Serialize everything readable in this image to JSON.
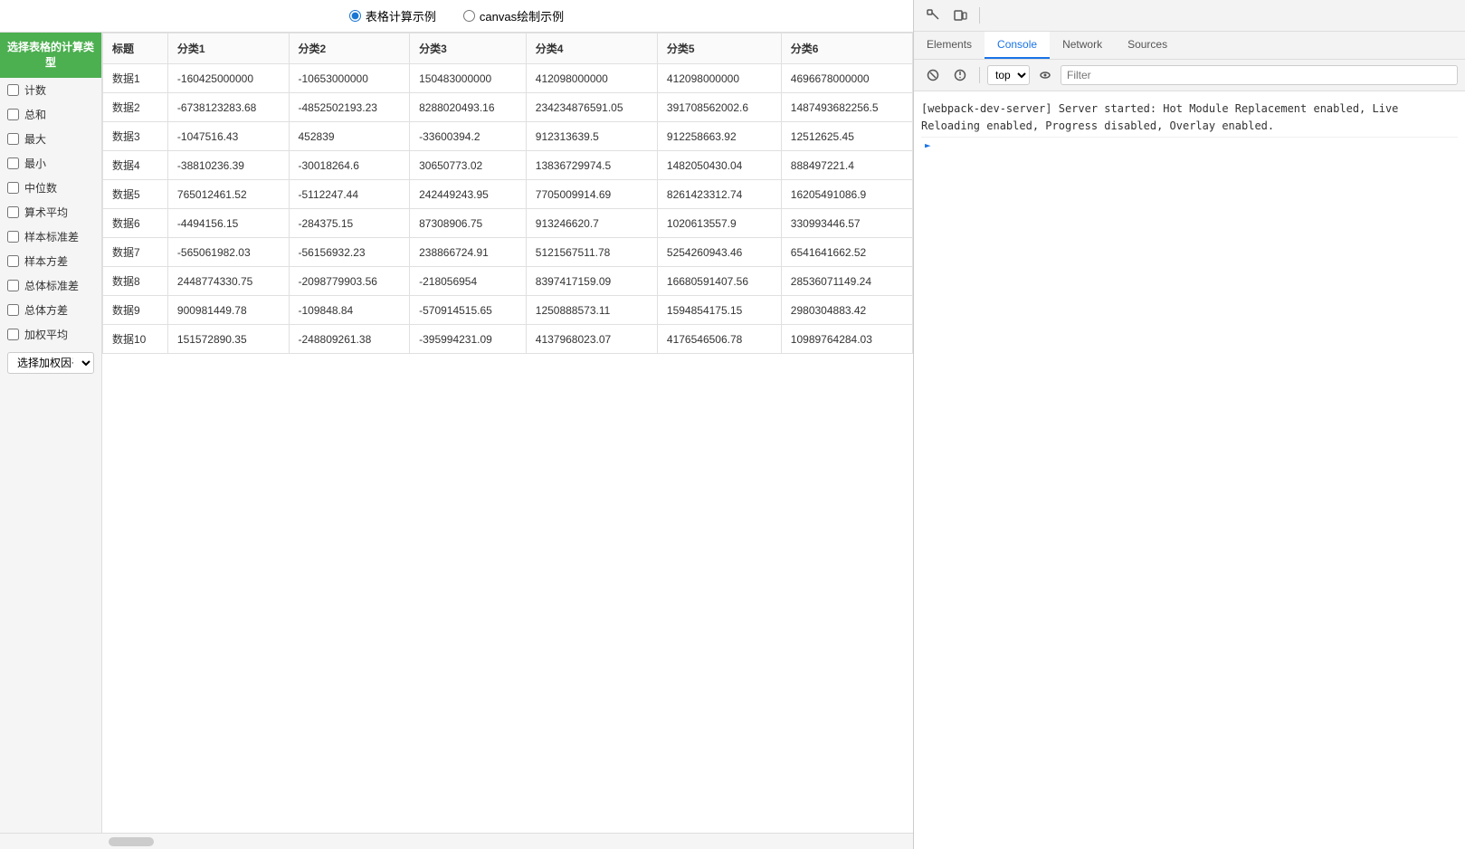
{
  "topbar": {
    "radio1_label": "表格计算示例",
    "radio2_label": "canvas绘制示例",
    "radio1_selected": true
  },
  "sidebar": {
    "title": "选择表格的计算类型",
    "items": [
      {
        "label": "计数",
        "checked": false
      },
      {
        "label": "总和",
        "checked": false
      },
      {
        "label": "最大",
        "checked": false
      },
      {
        "label": "最小",
        "checked": false
      },
      {
        "label": "中位数",
        "checked": false
      },
      {
        "label": "算术平均",
        "checked": false
      },
      {
        "label": "样本标准差",
        "checked": false
      },
      {
        "label": "样本方差",
        "checked": false
      },
      {
        "label": "总体标准差",
        "checked": false
      },
      {
        "label": "总体方差",
        "checked": false
      },
      {
        "label": "加权平均",
        "checked": false
      }
    ],
    "dropdown_placeholder": "选择加权因子",
    "dropdown_options": [
      "选择加权因子"
    ]
  },
  "table": {
    "headers": [
      "标题",
      "分类1",
      "分类2",
      "分类3",
      "分类4",
      "分类5",
      "分类6"
    ],
    "rows": [
      {
        "label": "数据1",
        "c1": "-160425000000",
        "c2": "-10653000000",
        "c3": "150483000000",
        "c4": "412098000000",
        "c5": "412098000000",
        "c6": "4696678000000"
      },
      {
        "label": "数据2",
        "c1": "-6738123283.68",
        "c2": "-4852502193.23",
        "c3": "8288020493.16",
        "c4": "234234876591.05",
        "c5": "391708562002.6",
        "c6": "1487493682256.5"
      },
      {
        "label": "数据3",
        "c1": "-1047516.43",
        "c2": "452839",
        "c3": "-33600394.2",
        "c4": "912313639.5",
        "c5": "912258663.92",
        "c6": "12512625.45"
      },
      {
        "label": "数据4",
        "c1": "-38810236.39",
        "c2": "-30018264.6",
        "c3": "30650773.02",
        "c4": "13836729974.5",
        "c5": "1482050430.04",
        "c6": "888497221.4"
      },
      {
        "label": "数据5",
        "c1": "765012461.52",
        "c2": "-5112247.44",
        "c3": "242449243.95",
        "c4": "7705009914.69",
        "c5": "8261423312.74",
        "c6": "16205491086.9"
      },
      {
        "label": "数据6",
        "c1": "-4494156.15",
        "c2": "-284375.15",
        "c3": "87308906.75",
        "c4": "913246620.7",
        "c5": "1020613557.9",
        "c6": "330993446.57"
      },
      {
        "label": "数据7",
        "c1": "-565061982.03",
        "c2": "-56156932.23",
        "c3": "238866724.91",
        "c4": "5121567511.78",
        "c5": "5254260943.46",
        "c6": "6541641662.52"
      },
      {
        "label": "数据8",
        "c1": "2448774330.75",
        "c2": "-2098779903.56",
        "c3": "-218056954",
        "c4": "8397417159.09",
        "c5": "16680591407.56",
        "c6": "28536071149.24"
      },
      {
        "label": "数据9",
        "c1": "900981449.78",
        "c2": "-109848.84",
        "c3": "-570914515.65",
        "c4": "1250888573.11",
        "c5": "1594854175.15",
        "c6": "2980304883.42"
      },
      {
        "label": "数据10",
        "c1": "151572890.35",
        "c2": "-248809261.38",
        "c3": "-395994231.09",
        "c4": "4137968023.07",
        "c5": "4176546506.78",
        "c6": "10989764284.03"
      }
    ]
  },
  "devtools": {
    "tabs": [
      "Elements",
      "Console",
      "Network",
      "Sources"
    ],
    "active_tab": "Console",
    "secondary_toolbar": {
      "top_label": "top",
      "filter_placeholder": "Filter"
    },
    "console_messages": [
      "[webpack-dev-server] Server started: Hot Module Replacement enabled, Live Reloading enabled, Progress disabled, Overlay enabled."
    ]
  }
}
